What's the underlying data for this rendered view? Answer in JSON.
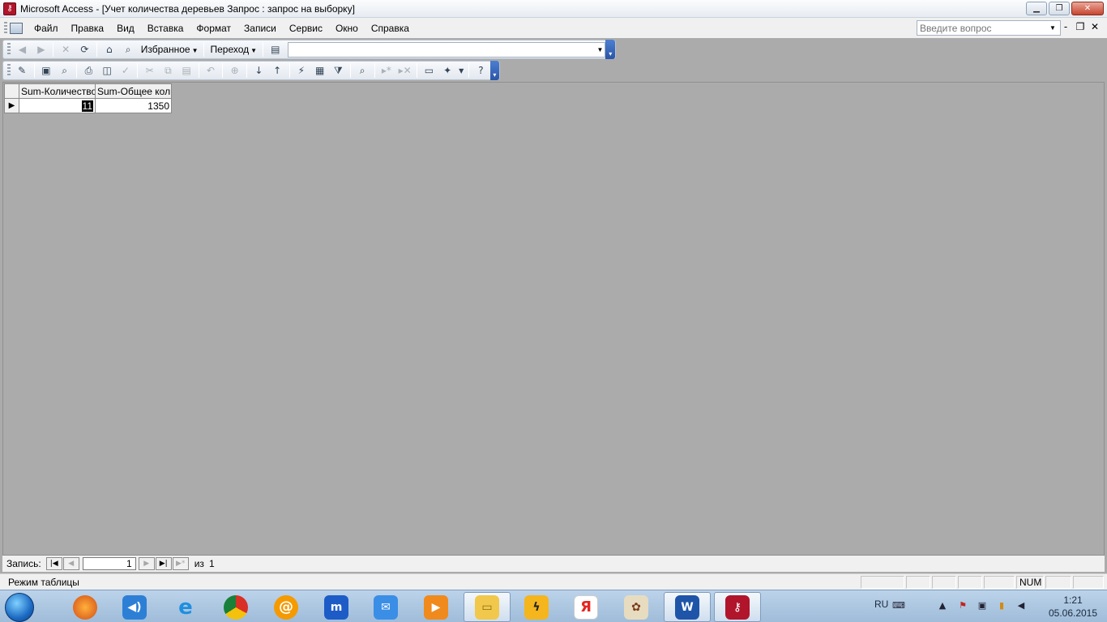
{
  "window": {
    "title": "Microsoft Access - [Учет количества деревьев Запрос : запрос на выборку]",
    "app_icon": "access-key-icon"
  },
  "menu": {
    "items": [
      {
        "label": "Файл"
      },
      {
        "label": "Правка"
      },
      {
        "label": "Вид"
      },
      {
        "label": "Вставка"
      },
      {
        "label": "Формат"
      },
      {
        "label": "Записи"
      },
      {
        "label": "Сервис"
      },
      {
        "label": "Окно"
      },
      {
        "label": "Справка"
      }
    ],
    "help_placeholder": "Введите вопрос"
  },
  "web_toolbar": {
    "favorites_label": "Избранное",
    "goto_label": "Переход",
    "address_value": ""
  },
  "datasheet": {
    "columns": [
      "Sum-Количество",
      "Sum-Общее количество"
    ],
    "rows": [
      [
        "11",
        "1350"
      ]
    ]
  },
  "navigation": {
    "record_label": "Запись:",
    "current_record": "1",
    "of_label": "из",
    "total_records": "1"
  },
  "status": {
    "mode_text": "Режим таблицы",
    "num_indicator": "NUM"
  },
  "taskbar": {
    "apps": [
      "firefox-icon",
      "speaker-icon",
      "internet-explorer-icon",
      "chrome-icon",
      "mail-ru-agent-icon",
      "maxthon-icon",
      "mail-icon",
      "media-player-icon",
      "explorer-icon",
      "winamp-icon",
      "yandex-icon",
      "mahjong-icon",
      "word-icon",
      "access-icon"
    ],
    "language": "RU",
    "time": "1:21",
    "date": "05.06.2015"
  },
  "colors": {
    "mdi_background": "#ababab",
    "toolbar_end": "#2b55a8",
    "access_brand": "#b0152b"
  }
}
